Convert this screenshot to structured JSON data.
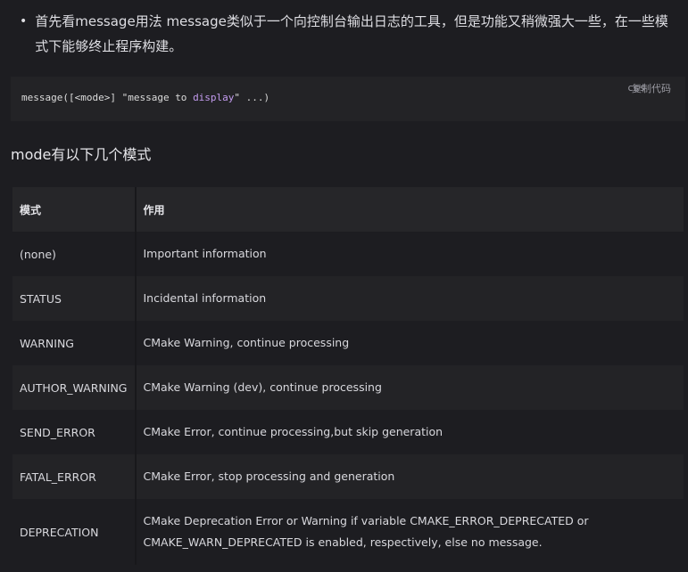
{
  "bullet": {
    "dot": "•",
    "text": "首先看message用法 message类似于一个向控制台输出日志的工具，但是功能又稍微强大一些，在一些模式下能够终止程序构建。"
  },
  "code_block": {
    "lang": "css",
    "copy_label": "复制代码",
    "parts": [
      "message([<mode>] \"message ",
      "to",
      " ",
      "display",
      "\" ...)"
    ]
  },
  "section_title": "mode有以下几个模式",
  "table": {
    "headers": [
      "模式",
      "作用"
    ],
    "rows": [
      {
        "mode": "(none)",
        "desc": "Important information"
      },
      {
        "mode": "STATUS",
        "desc": "Incidental information"
      },
      {
        "mode": "WARNING",
        "desc": "CMake Warning, continue processing"
      },
      {
        "mode": "AUTHOR_WARNING",
        "desc": "CMake Warning (dev), continue processing"
      },
      {
        "mode": "SEND_ERROR",
        "desc": "CMake Error, continue processing,but skip generation"
      },
      {
        "mode": "FATAL_ERROR",
        "desc": "CMake Error, stop processing and generation"
      },
      {
        "mode": "DEPRECATION",
        "desc": "CMake Deprecation Error or Warning if variable CMAKE_ERROR_DEPRECATED or CMAKE_WARN_DEPRECATED is enabled, respectively, else no message."
      }
    ]
  }
}
